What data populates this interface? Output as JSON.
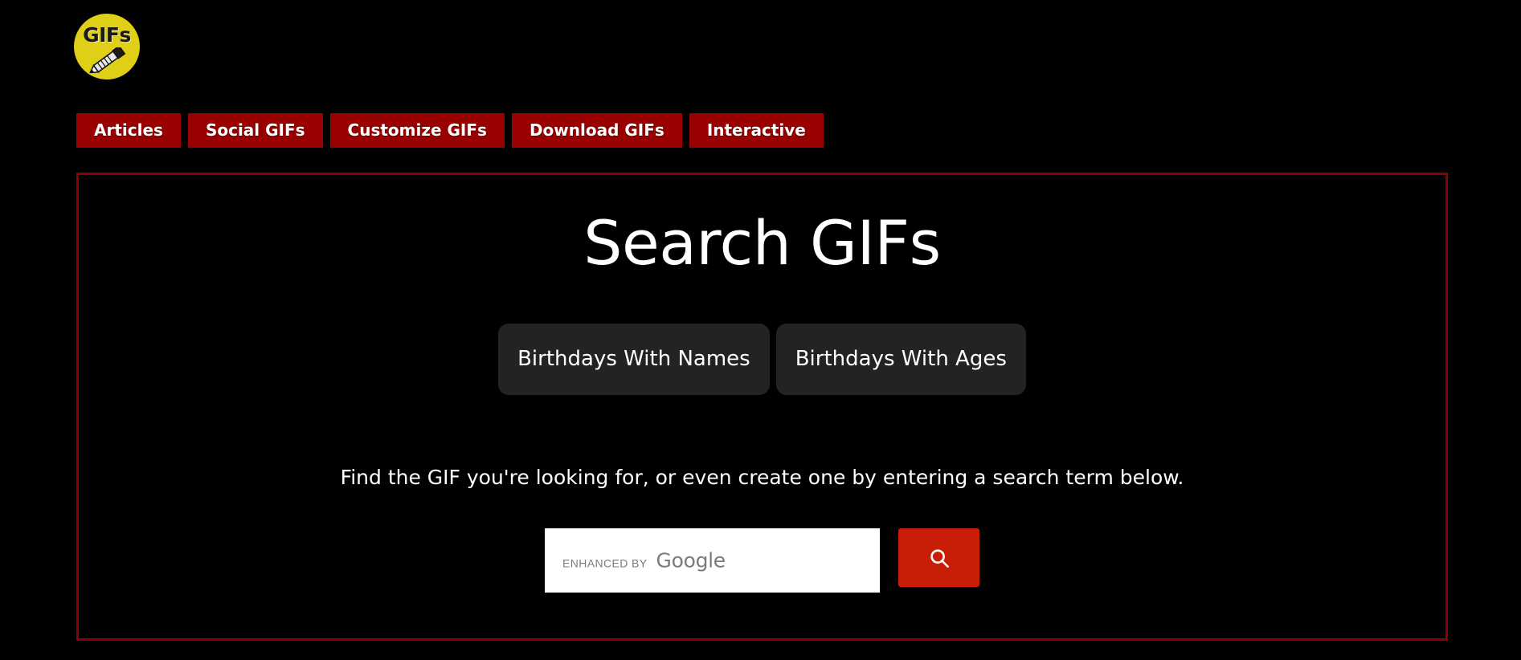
{
  "site": {
    "logo": {
      "icon": "gifs-pencil-logo-icon",
      "text": "GIFs",
      "circle_color": "#e0cf17"
    }
  },
  "colors": {
    "background": "#000000",
    "nav_button": "#990000",
    "panel_border": "#8c0000",
    "pill_background": "#232323",
    "search_button": "#c81e07",
    "text": "#ffffff"
  },
  "nav": {
    "items": [
      {
        "label": "Articles"
      },
      {
        "label": "Social GIFs"
      },
      {
        "label": "Customize GIFs"
      },
      {
        "label": "Download GIFs"
      },
      {
        "label": "Interactive"
      }
    ]
  },
  "hero": {
    "title": "Search GIFs",
    "pills": [
      {
        "label": "Birthdays With Names"
      },
      {
        "label": "Birthdays With Ages"
      }
    ],
    "description": "Find the GIF you're looking for, or even create one by entering a search term below.",
    "search": {
      "value": "",
      "placeholder": "",
      "enhanced_by_label": "ENHANCED BY",
      "provider_label": "Google",
      "button_icon": "search-icon"
    }
  }
}
